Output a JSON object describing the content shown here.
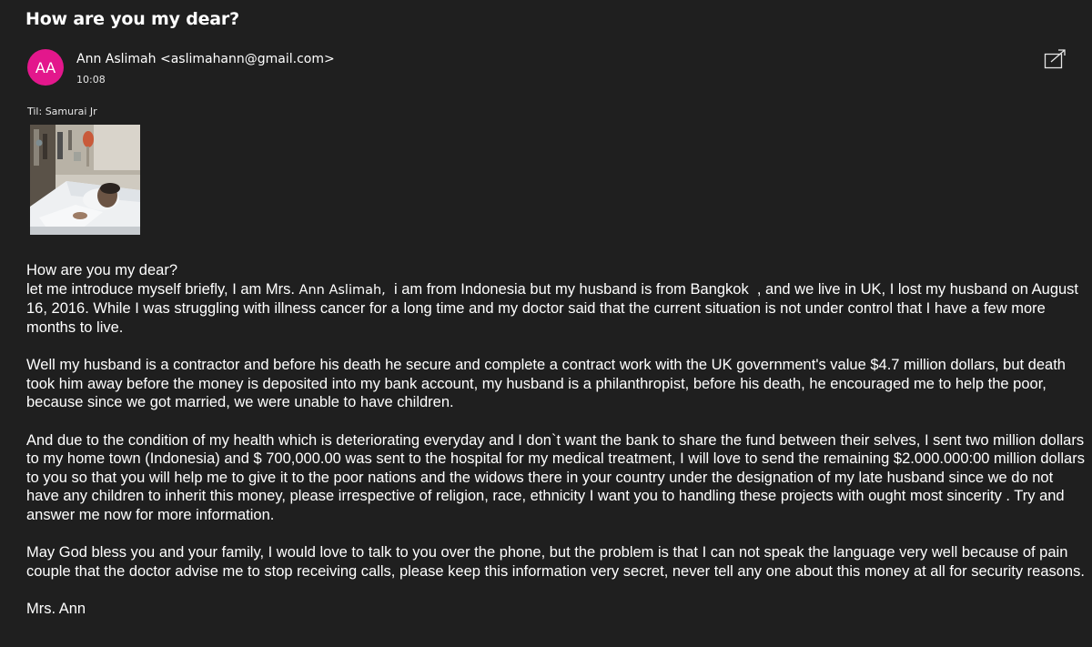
{
  "email": {
    "subject": "How are you my dear?",
    "sender_initials": "AA",
    "sender": "Ann Aslimah <aslimahann@gmail.com>",
    "time": "10:08",
    "recipient": "Til: Samurai Jr",
    "colors": {
      "background": "#1f1f1f",
      "avatar": "#e3178c",
      "text": "#ffffff"
    },
    "icons": {
      "popout": "open-in-new-window-icon"
    },
    "body": {
      "greeting": "How are you my dear?",
      "intro_before_name": "let me introduce myself briefly, I am Mrs.",
      "intro_name": "Ann Aslimah,",
      "intro_after_name": "  i am from Indonesia but my husband is from Bangkok  , and we live in UK, I lost my husband on August 16, 2016. While I was struggling with illness cancer for a long time and my doctor said that the current situation is not under control that I have a few more months to live.",
      "paragraph2": "Well my husband is a contractor and before his death he secure and complete a contract work with the UK government's value $4.7 million dollars, but death took him away before the money is deposited into my bank account, my husband is a philanthropist, before his death, he encouraged me to help the poor, because since we got married, we were unable to have children.",
      "paragraph3": "And due to the condition of my health which is deteriorating everyday and I don`t want the bank  to share the fund between their selves, I sent two million dollars to my home town (Indonesia) and $ 700,000.00 was sent to the hospital for my medical treatment, I will love to send the remaining $2.000.000:00 million dollars to you so that you will help me to give it to the poor nations and the widows there in your country under the designation of my late husband since we do not have any children to inherit this money, please irrespective of religion, race, ethnicity I want you to handling these projects with ought most sincerity . Try and answer me now for more information.",
      "paragraph4": "May God bless you and your family, I would love to talk to you over the phone, but the problem is that I can not speak the language very well because of pain couple that the doctor advise me to stop receiving calls, please keep this information very secret, never tell any one about this money at all for security reasons.",
      "signature": "Mrs. Ann"
    }
  }
}
